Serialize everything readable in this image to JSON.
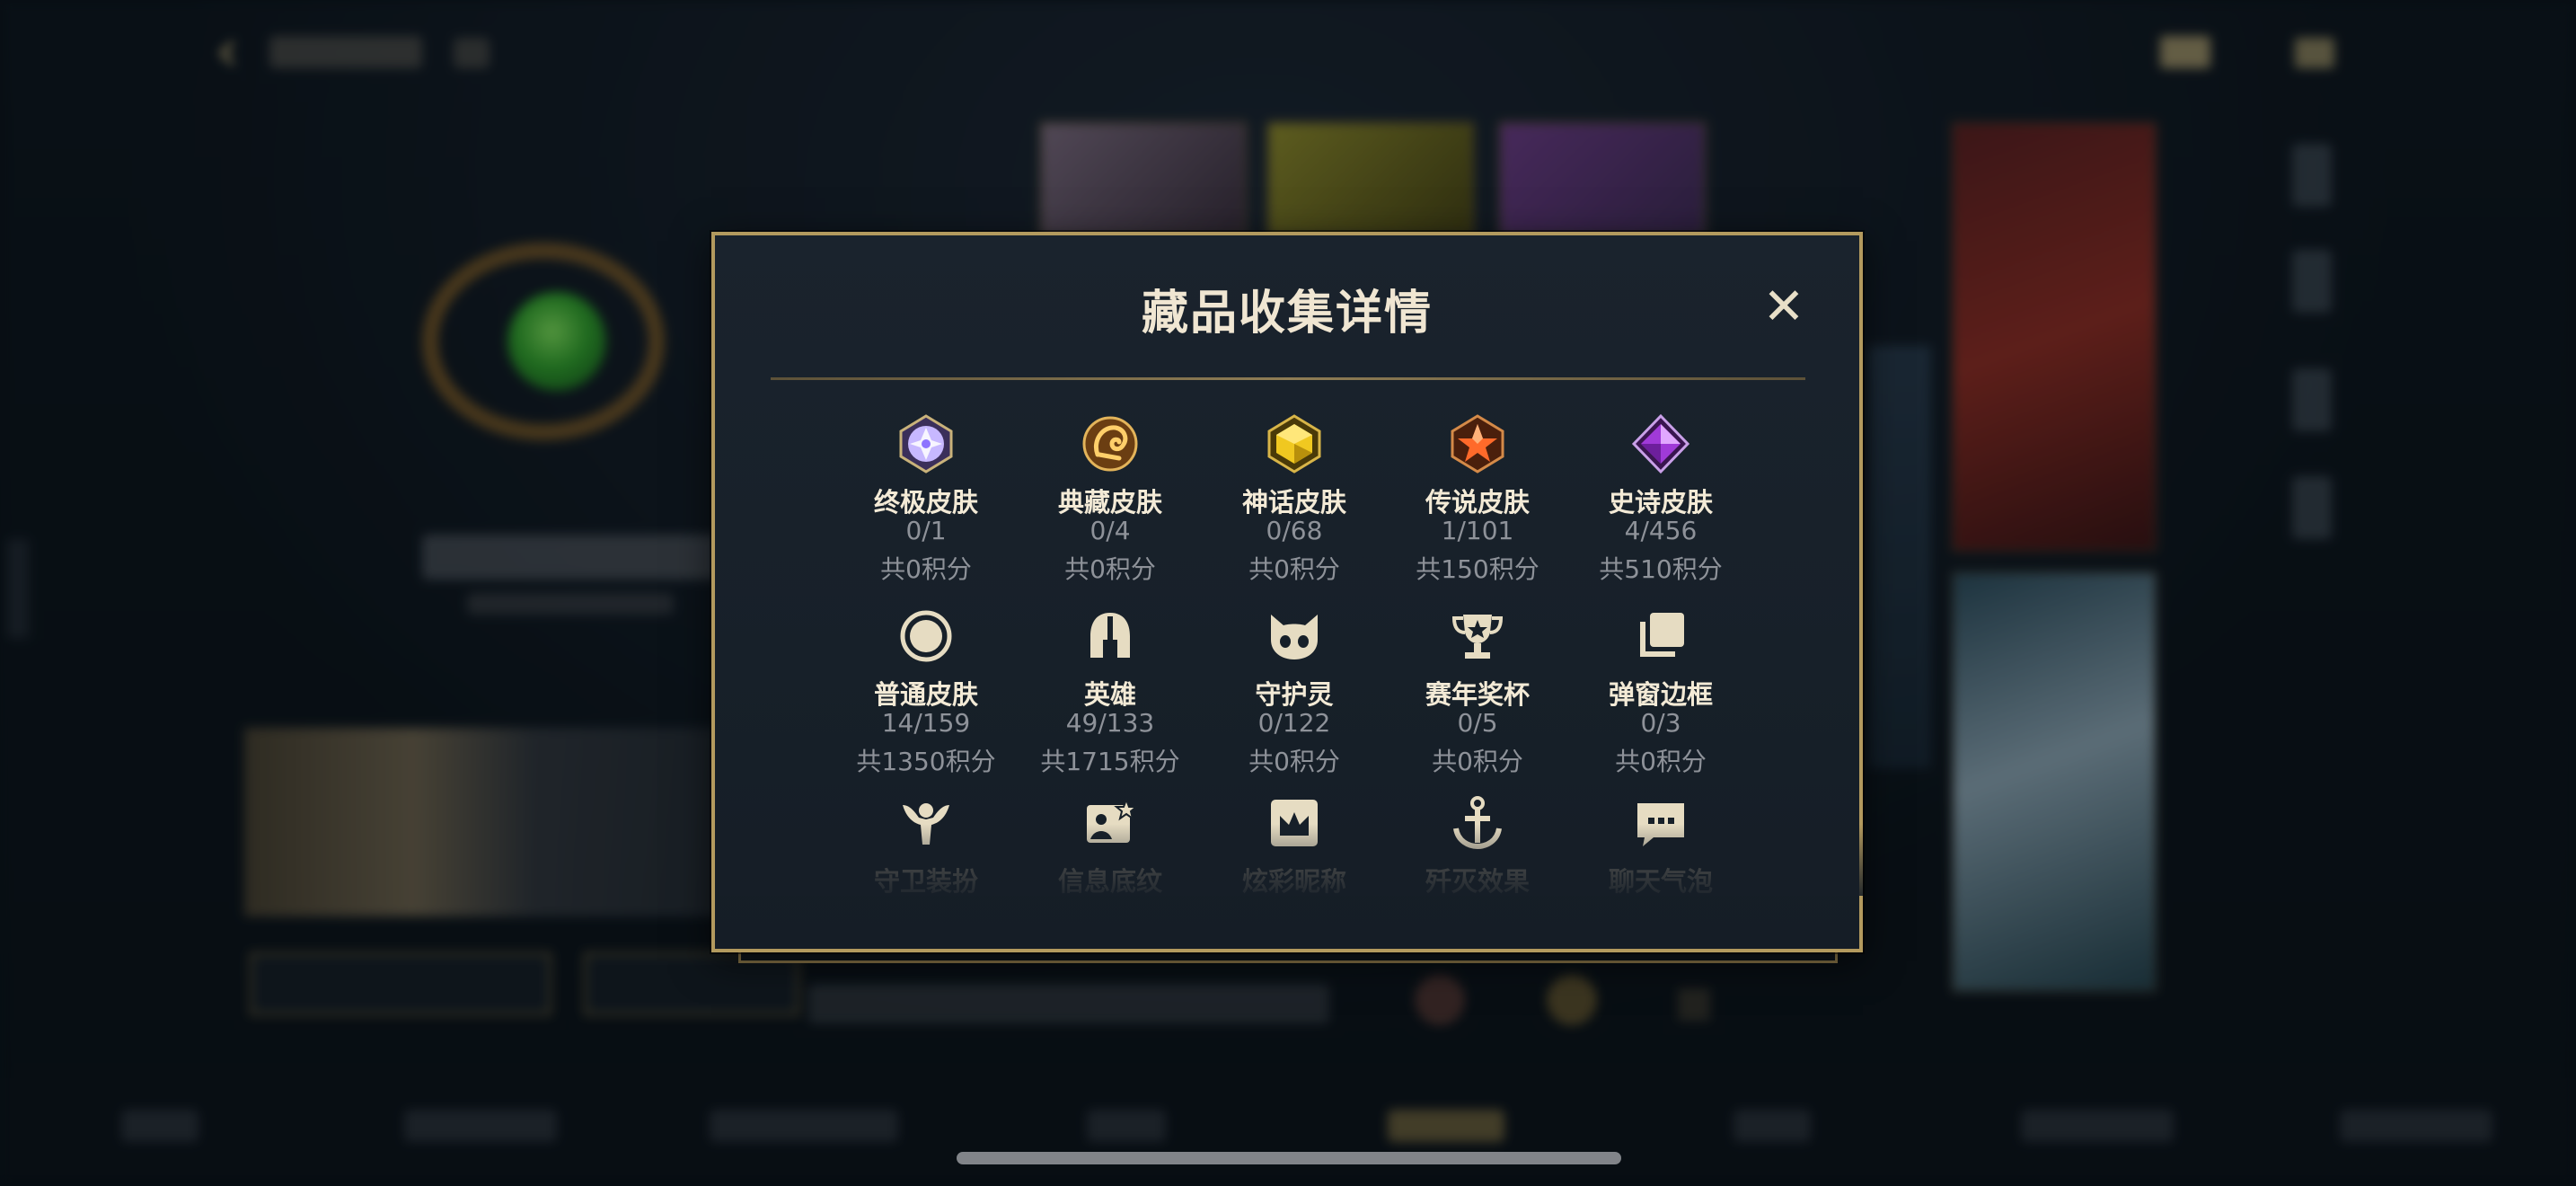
{
  "modal": {
    "title": "藏品收集详情",
    "close_label": "✕"
  },
  "collections": [
    {
      "label": "终极皮肤",
      "count": "0/1",
      "points": "共0积分",
      "icon": "ultimate-skin-gem-icon",
      "color": "#b49cff"
    },
    {
      "label": "典藏皮肤",
      "count": "0/4",
      "points": "共0积分",
      "icon": "prestige-skin-dragon-icon",
      "color": "#e0a43a"
    },
    {
      "label": "神话皮肤",
      "count": "0/68",
      "points": "共0积分",
      "icon": "mythic-skin-gem-icon",
      "color": "#e8c22a"
    },
    {
      "label": "传说皮肤",
      "count": "1/101",
      "points": "共150积分",
      "icon": "legendary-skin-gem-icon",
      "color": "#e0652a"
    },
    {
      "label": "史诗皮肤",
      "count": "4/456",
      "points": "共510积分",
      "icon": "epic-skin-gem-icon",
      "color": "#a43ad8"
    },
    {
      "label": "普通皮肤",
      "count": "14/159",
      "points": "共1350积分",
      "icon": "normal-skin-circle-icon",
      "color": "#e6dcc2"
    },
    {
      "label": "英雄",
      "count": "49/133",
      "points": "共1715积分",
      "icon": "champion-helmet-icon",
      "color": "#e6dcc2"
    },
    {
      "label": "守护灵",
      "count": "0/122",
      "points": "共0积分",
      "icon": "guardian-spirit-icon",
      "color": "#e6dcc2"
    },
    {
      "label": "赛年奖杯",
      "count": "0/5",
      "points": "共0积分",
      "icon": "season-trophy-icon",
      "color": "#e6dcc2"
    },
    {
      "label": "弹窗边框",
      "count": "0/3",
      "points": "共0积分",
      "icon": "popup-frame-icon",
      "color": "#e6dcc2"
    },
    {
      "label": "守卫装扮",
      "icon": "ward-skin-icon",
      "color": "#e6dcc2"
    },
    {
      "label": "信息底纹",
      "icon": "info-card-background-icon",
      "color": "#e6dcc2"
    },
    {
      "label": "炫彩昵称",
      "icon": "colorful-nickname-icon",
      "color": "#e6dcc2"
    },
    {
      "label": "歼灭效果",
      "icon": "ace-effect-icon",
      "color": "#e6dcc2"
    },
    {
      "label": "聊天气泡",
      "icon": "chat-bubble-icon",
      "color": "#e6dcc2"
    }
  ]
}
